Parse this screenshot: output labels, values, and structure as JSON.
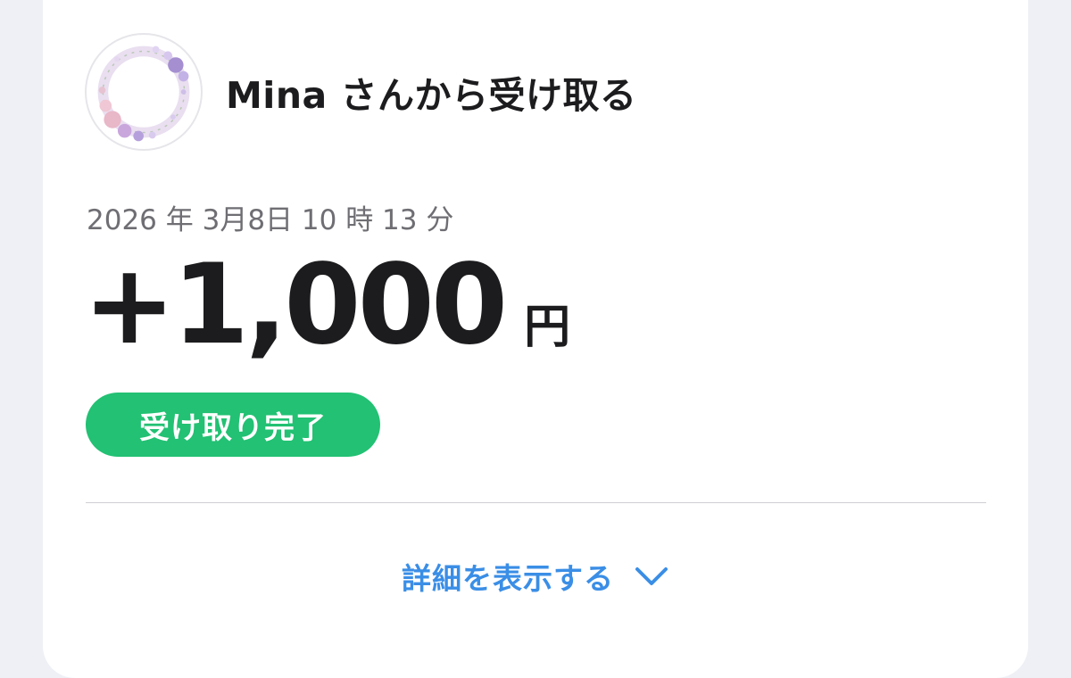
{
  "header": {
    "title": "Mina さんから受け取る",
    "avatar_icon": "flower-wreath-avatar"
  },
  "transaction": {
    "datetime": "2026 年 3月8日 10 時 13 分",
    "amount": "+1,000",
    "currency": "円",
    "status": "受け取り完了",
    "status_color": "#22c173"
  },
  "details": {
    "label": "詳細を表示する",
    "icon": "chevron-down-icon",
    "color": "#3a8ee6"
  }
}
